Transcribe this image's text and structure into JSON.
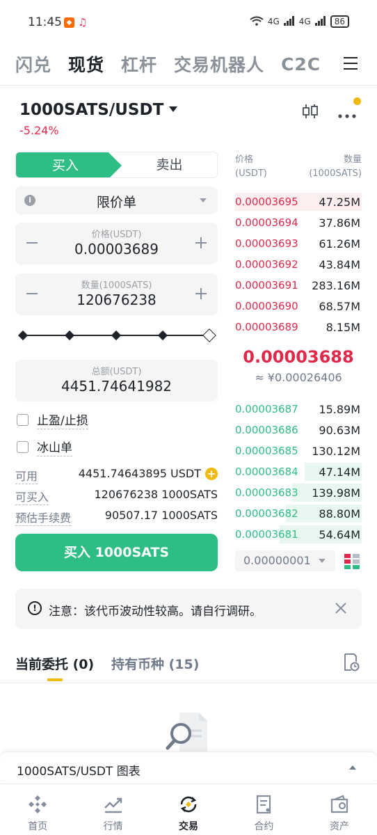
{
  "status_bar": {
    "time": "11:45",
    "signal_text": "4G",
    "battery": "86"
  },
  "top_tabs": [
    "闪兑",
    "现货",
    "杠杆",
    "交易机器人",
    "C2C"
  ],
  "active_top_tab": 1,
  "pair": {
    "name": "1000SATS/USDT",
    "change": "-5.24%"
  },
  "side_tabs": {
    "buy": "买入",
    "sell": "卖出"
  },
  "order_type": "限价单",
  "price": {
    "label": "价格(USDT)",
    "value": "0.00003689"
  },
  "quantity": {
    "label": "数量(1000SATS)",
    "value": "120676238"
  },
  "slider_level": 1.0,
  "total": {
    "label": "总额(USDT)",
    "value": "4451.74641982"
  },
  "options": {
    "tp_sl": "止盈/止损",
    "iceberg": "冰山单"
  },
  "info": {
    "available_label": "可用",
    "available_value": "4451.74643895 USDT",
    "can_buy_label": "可买入",
    "can_buy_value": "120676238 1000SATS",
    "fee_label": "预估手续费",
    "fee_value": "90507.17 1000SATS"
  },
  "buy_button": "买入 1000SATS",
  "order_book": {
    "price_header": "价格",
    "price_unit": "(USDT)",
    "qty_header": "数量",
    "qty_unit": "(1000SATS)",
    "asks": [
      {
        "price": "0.00003695",
        "qty": "47.25M",
        "depth": 1.0
      },
      {
        "price": "0.00003694",
        "qty": "37.86M",
        "depth": 0.0
      },
      {
        "price": "0.00003693",
        "qty": "61.26M",
        "depth": 0.0
      },
      {
        "price": "0.00003692",
        "qty": "43.84M",
        "depth": 0.0
      },
      {
        "price": "0.00003691",
        "qty": "283.16M",
        "depth": 0.0
      },
      {
        "price": "0.00003690",
        "qty": "68.57M",
        "depth": 0.0
      },
      {
        "price": "0.00003689",
        "qty": "8.15M",
        "depth": 0.0
      }
    ],
    "mid_price": "0.00003688",
    "mid_fiat": "≈ ¥0.00026406",
    "bids": [
      {
        "price": "0.00003687",
        "qty": "15.89M",
        "depth": 0.0
      },
      {
        "price": "0.00003686",
        "qty": "90.63M",
        "depth": 0.0
      },
      {
        "price": "0.00003685",
        "qty": "130.12M",
        "depth": 0.0
      },
      {
        "price": "0.00003684",
        "qty": "47.14M",
        "depth": 0.45
      },
      {
        "price": "0.00003683",
        "qty": "139.98M",
        "depth": 0.55
      },
      {
        "price": "0.00003682",
        "qty": "88.80M",
        "depth": 0.6
      },
      {
        "price": "0.00003681",
        "qty": "54.64M",
        "depth": 0.65
      }
    ],
    "tick_size": "0.00000001"
  },
  "notice": "注意：该代币波动性较高。请自行调研。",
  "orders_tabs": {
    "current": "当前委托 (0)",
    "holdings": "持有币种 (15)"
  },
  "chart_bar": "1000SATS/USDT 图表",
  "bottom_nav": [
    "首页",
    "行情",
    "交易",
    "合约",
    "资产"
  ],
  "active_nav": 2,
  "colors": {
    "buy_green": "#2ebd85",
    "sell_red": "#e0294a",
    "accent_yellow": "#f0b90b"
  }
}
